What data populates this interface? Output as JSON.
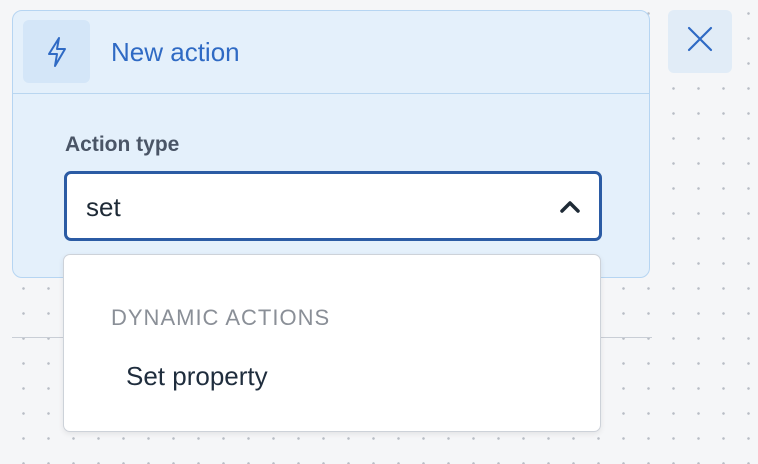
{
  "panel": {
    "title": "New action",
    "header_icon": "lightning-bolt-icon"
  },
  "form": {
    "action_type_label": "Action type",
    "action_type_value": "set"
  },
  "close_button": {
    "icon": "close-icon"
  },
  "dropdown": {
    "group_label": "DYNAMIC ACTIONS",
    "options": [
      {
        "label": "Set property"
      }
    ]
  },
  "colors": {
    "accent": "#2f6ac4",
    "focus_border": "#2b5ba4",
    "panel_background": "#e4f0fb"
  }
}
